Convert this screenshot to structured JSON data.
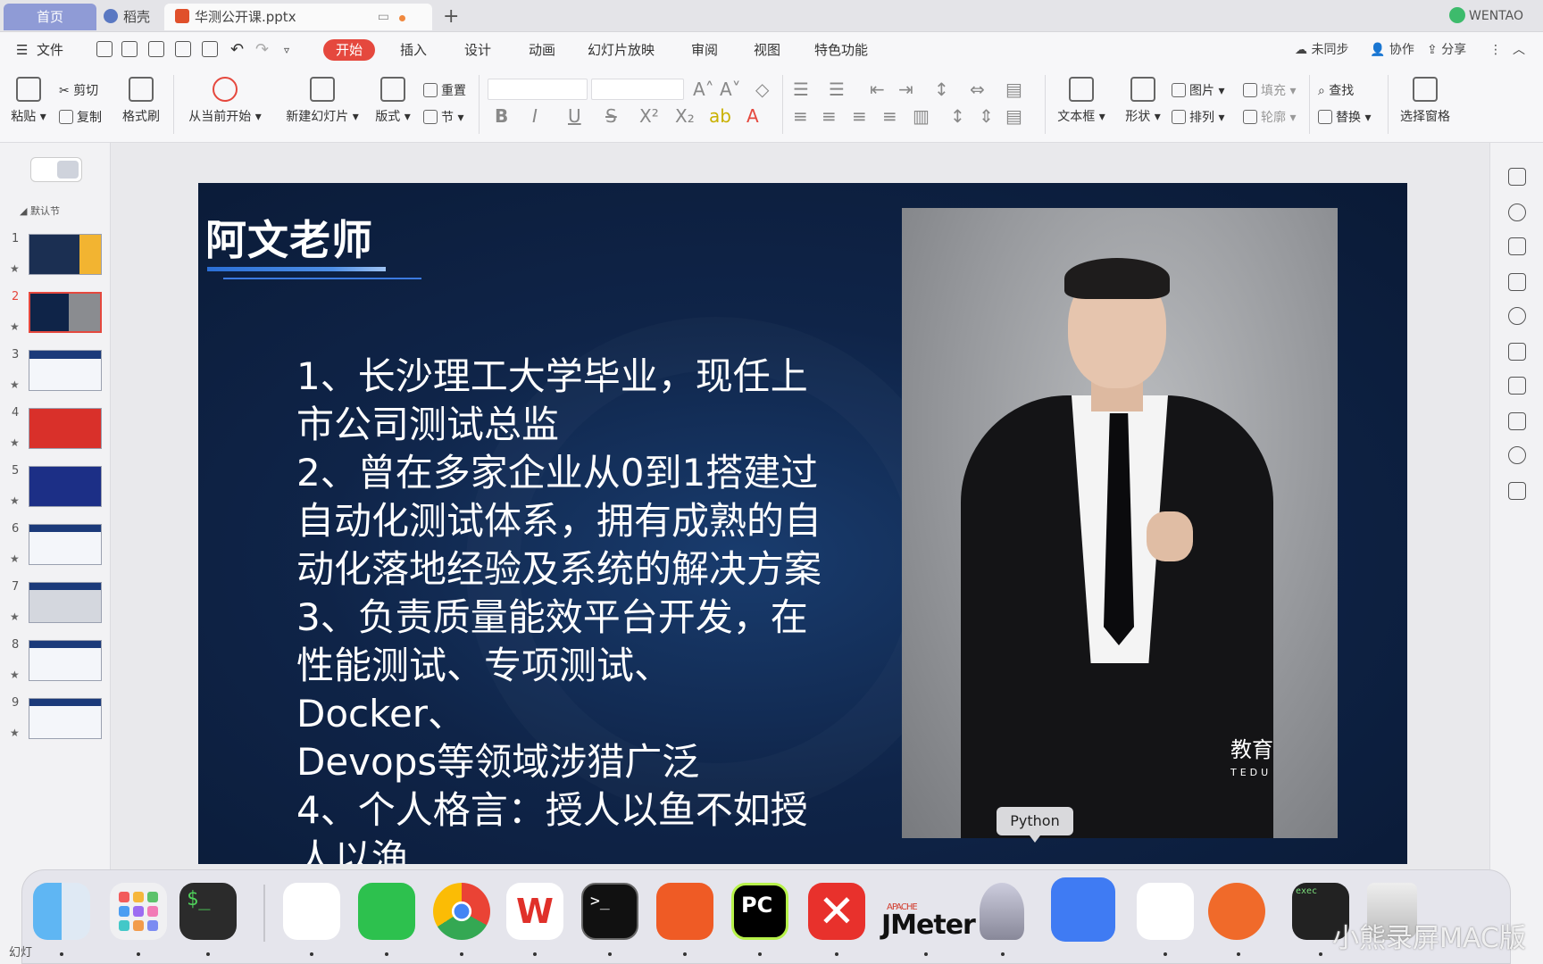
{
  "tabs": [
    {
      "label": "首页"
    },
    {
      "label": "稻壳"
    },
    {
      "label": "华测公开课.pptx"
    }
  ],
  "user": {
    "name": "WENTAO"
  },
  "menu": {
    "file": "文件",
    "items": [
      "开始",
      "插入",
      "设计",
      "动画",
      "幻灯片放映",
      "审阅",
      "视图",
      "特色功能"
    ],
    "active": "开始",
    "sync": "未同步",
    "collab": "协作",
    "share": "分享"
  },
  "ribbon": {
    "paste": "粘贴",
    "cut": "剪切",
    "copy": "复制",
    "format_painter": "格式刷",
    "from_current": "从当前开始",
    "new_slide": "新建幻灯片",
    "layout": "版式",
    "reset": "重置",
    "section": "节",
    "textbox": "文本框",
    "shape": "形状",
    "picture": "图片",
    "arrange": "排列",
    "fill": "填充",
    "outline": "轮廓",
    "find": "查找",
    "replace": "替换",
    "select_pane": "选择窗格"
  },
  "panel": {
    "section_label": "默认节",
    "slides": [
      "1",
      "2",
      "3",
      "4",
      "5",
      "6",
      "7",
      "8",
      "9"
    ],
    "selected": "2"
  },
  "slide": {
    "title": "阿文老师",
    "body": [
      "1、长沙理工大学毕业，现任上",
      "市公司测试总监",
      "2、曾在多家企业从0到1搭建过",
      "自动化测试体系，拥有成熟的自",
      "动化落地经验及系统的解决方案",
      "3、负责质量能效平台开发，在",
      "性能测试、专项测试、Docker、",
      "Devops等领域涉猎广泛",
      "4、个人格言：授人以鱼不如授",
      "人以渔"
    ],
    "logo_text": "教育",
    "logo_sub": "TEDU"
  },
  "tooltip": "Python",
  "dock": {
    "apps": [
      "finder",
      "launchpad",
      "terminal",
      "qq",
      "wechat",
      "chrome",
      "wps",
      "terminal-2",
      "postman",
      "pycharm",
      "xmind",
      "jmeter",
      "python-launcher",
      "notes",
      "tencent-video",
      "recorder",
      "exec",
      "trash"
    ],
    "jmeter_brand": "APACHE",
    "jmeter_label": "JMeter",
    "exec_label": "exec",
    "term_label": "$_",
    "term2_label": ">_",
    "pycharm_label": "PC"
  },
  "watermark": "小熊录屏MAC版",
  "bottom_label": "幻灯"
}
